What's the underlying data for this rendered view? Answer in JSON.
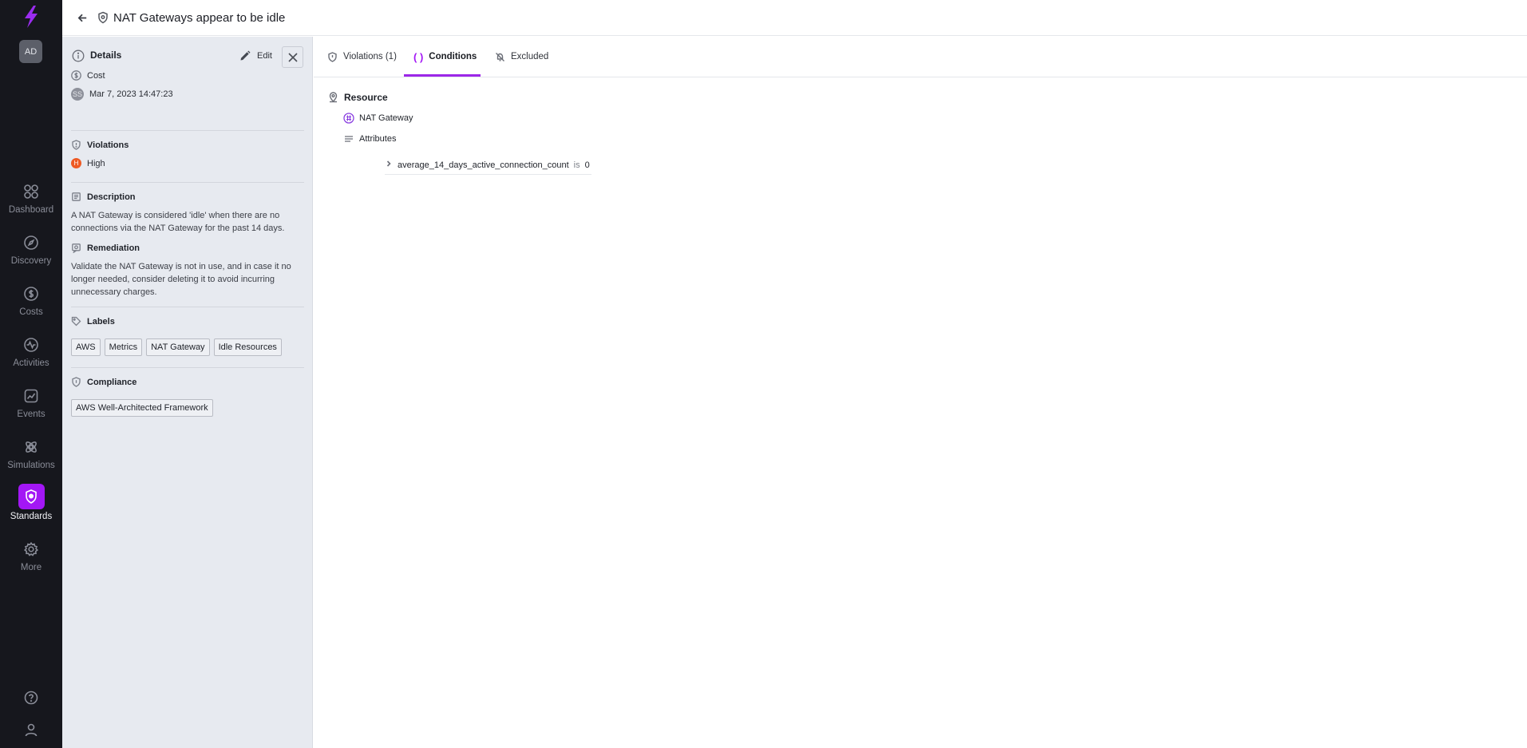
{
  "header": {
    "title": "NAT Gateways appear to be idle"
  },
  "user": {
    "initials": "AD"
  },
  "nav": {
    "items": [
      {
        "label": "Dashboard",
        "icon": "dashboard-icon"
      },
      {
        "label": "Discovery",
        "icon": "compass-icon"
      },
      {
        "label": "Costs",
        "icon": "dollar-icon"
      },
      {
        "label": "Activities",
        "icon": "activity-icon"
      },
      {
        "label": "Events",
        "icon": "events-icon"
      },
      {
        "label": "Simulations",
        "icon": "simulations-icon"
      },
      {
        "label": "Standards",
        "icon": "shield-icon",
        "active": true
      },
      {
        "label": "More",
        "icon": "gear-icon"
      }
    ]
  },
  "details": {
    "title": "Details",
    "edit_label": "Edit",
    "cost": {
      "label": "Cost",
      "owner_initials": "SS",
      "timestamp": "Mar 7, 2023 14:47:23"
    },
    "violations": {
      "label": "Violations",
      "severity_initial": "H",
      "severity": "High"
    },
    "description": {
      "label": "Description",
      "text": "A NAT Gateway is considered 'idle' when there are no connections via the NAT Gateway for the past 14 days."
    },
    "remediation": {
      "label": "Remediation",
      "text": "Validate the NAT Gateway is not in use, and in case it no longer needed, consider deleting it to avoid incurring unnecessary charges."
    },
    "labels": {
      "label": "Labels",
      "items": [
        "AWS",
        "Metrics",
        "NAT Gateway",
        "Idle Resources"
      ]
    },
    "compliance": {
      "label": "Compliance",
      "items": [
        "AWS Well-Architected Framework"
      ]
    }
  },
  "tabs": [
    {
      "label": "Violations (1)"
    },
    {
      "label": "Conditions",
      "active": true
    },
    {
      "label": "Excluded"
    }
  ],
  "conditions": {
    "heading": "Resource",
    "resource_type": "NAT Gateway",
    "attributes_label": "Attributes",
    "condition": {
      "attribute": "average_14_days_active_connection_count",
      "operator": "is",
      "value": "0"
    }
  },
  "colors": {
    "accent": "#a317f5",
    "rail": "#16171d",
    "panel": "#e7eaf0",
    "severity_high": "#ee5a24"
  }
}
